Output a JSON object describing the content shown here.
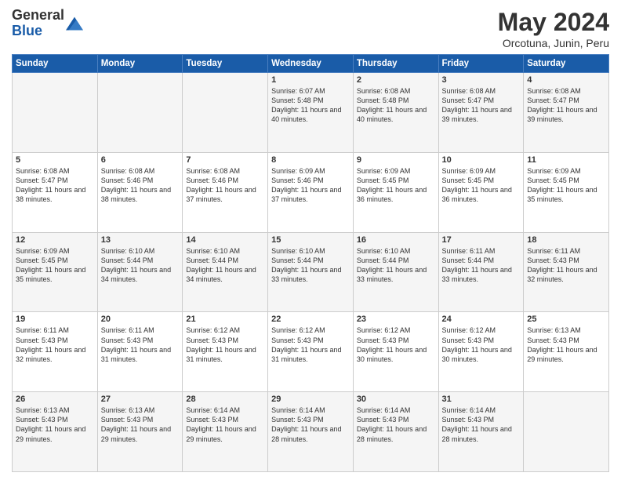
{
  "header": {
    "logo_general": "General",
    "logo_blue": "Blue",
    "month_year": "May 2024",
    "location": "Orcotuna, Junin, Peru"
  },
  "days_of_week": [
    "Sunday",
    "Monday",
    "Tuesday",
    "Wednesday",
    "Thursday",
    "Friday",
    "Saturday"
  ],
  "weeks": [
    [
      {
        "day": "",
        "sunrise": "",
        "sunset": "",
        "daylight": ""
      },
      {
        "day": "",
        "sunrise": "",
        "sunset": "",
        "daylight": ""
      },
      {
        "day": "",
        "sunrise": "",
        "sunset": "",
        "daylight": ""
      },
      {
        "day": "1",
        "sunrise": "Sunrise: 6:07 AM",
        "sunset": "Sunset: 5:48 PM",
        "daylight": "Daylight: 11 hours and 40 minutes."
      },
      {
        "day": "2",
        "sunrise": "Sunrise: 6:08 AM",
        "sunset": "Sunset: 5:48 PM",
        "daylight": "Daylight: 11 hours and 40 minutes."
      },
      {
        "day": "3",
        "sunrise": "Sunrise: 6:08 AM",
        "sunset": "Sunset: 5:47 PM",
        "daylight": "Daylight: 11 hours and 39 minutes."
      },
      {
        "day": "4",
        "sunrise": "Sunrise: 6:08 AM",
        "sunset": "Sunset: 5:47 PM",
        "daylight": "Daylight: 11 hours and 39 minutes."
      }
    ],
    [
      {
        "day": "5",
        "sunrise": "Sunrise: 6:08 AM",
        "sunset": "Sunset: 5:47 PM",
        "daylight": "Daylight: 11 hours and 38 minutes."
      },
      {
        "day": "6",
        "sunrise": "Sunrise: 6:08 AM",
        "sunset": "Sunset: 5:46 PM",
        "daylight": "Daylight: 11 hours and 38 minutes."
      },
      {
        "day": "7",
        "sunrise": "Sunrise: 6:08 AM",
        "sunset": "Sunset: 5:46 PM",
        "daylight": "Daylight: 11 hours and 37 minutes."
      },
      {
        "day": "8",
        "sunrise": "Sunrise: 6:09 AM",
        "sunset": "Sunset: 5:46 PM",
        "daylight": "Daylight: 11 hours and 37 minutes."
      },
      {
        "day": "9",
        "sunrise": "Sunrise: 6:09 AM",
        "sunset": "Sunset: 5:45 PM",
        "daylight": "Daylight: 11 hours and 36 minutes."
      },
      {
        "day": "10",
        "sunrise": "Sunrise: 6:09 AM",
        "sunset": "Sunset: 5:45 PM",
        "daylight": "Daylight: 11 hours and 36 minutes."
      },
      {
        "day": "11",
        "sunrise": "Sunrise: 6:09 AM",
        "sunset": "Sunset: 5:45 PM",
        "daylight": "Daylight: 11 hours and 35 minutes."
      }
    ],
    [
      {
        "day": "12",
        "sunrise": "Sunrise: 6:09 AM",
        "sunset": "Sunset: 5:45 PM",
        "daylight": "Daylight: 11 hours and 35 minutes."
      },
      {
        "day": "13",
        "sunrise": "Sunrise: 6:10 AM",
        "sunset": "Sunset: 5:44 PM",
        "daylight": "Daylight: 11 hours and 34 minutes."
      },
      {
        "day": "14",
        "sunrise": "Sunrise: 6:10 AM",
        "sunset": "Sunset: 5:44 PM",
        "daylight": "Daylight: 11 hours and 34 minutes."
      },
      {
        "day": "15",
        "sunrise": "Sunrise: 6:10 AM",
        "sunset": "Sunset: 5:44 PM",
        "daylight": "Daylight: 11 hours and 33 minutes."
      },
      {
        "day": "16",
        "sunrise": "Sunrise: 6:10 AM",
        "sunset": "Sunset: 5:44 PM",
        "daylight": "Daylight: 11 hours and 33 minutes."
      },
      {
        "day": "17",
        "sunrise": "Sunrise: 6:11 AM",
        "sunset": "Sunset: 5:44 PM",
        "daylight": "Daylight: 11 hours and 33 minutes."
      },
      {
        "day": "18",
        "sunrise": "Sunrise: 6:11 AM",
        "sunset": "Sunset: 5:43 PM",
        "daylight": "Daylight: 11 hours and 32 minutes."
      }
    ],
    [
      {
        "day": "19",
        "sunrise": "Sunrise: 6:11 AM",
        "sunset": "Sunset: 5:43 PM",
        "daylight": "Daylight: 11 hours and 32 minutes."
      },
      {
        "day": "20",
        "sunrise": "Sunrise: 6:11 AM",
        "sunset": "Sunset: 5:43 PM",
        "daylight": "Daylight: 11 hours and 31 minutes."
      },
      {
        "day": "21",
        "sunrise": "Sunrise: 6:12 AM",
        "sunset": "Sunset: 5:43 PM",
        "daylight": "Daylight: 11 hours and 31 minutes."
      },
      {
        "day": "22",
        "sunrise": "Sunrise: 6:12 AM",
        "sunset": "Sunset: 5:43 PM",
        "daylight": "Daylight: 11 hours and 31 minutes."
      },
      {
        "day": "23",
        "sunrise": "Sunrise: 6:12 AM",
        "sunset": "Sunset: 5:43 PM",
        "daylight": "Daylight: 11 hours and 30 minutes."
      },
      {
        "day": "24",
        "sunrise": "Sunrise: 6:12 AM",
        "sunset": "Sunset: 5:43 PM",
        "daylight": "Daylight: 11 hours and 30 minutes."
      },
      {
        "day": "25",
        "sunrise": "Sunrise: 6:13 AM",
        "sunset": "Sunset: 5:43 PM",
        "daylight": "Daylight: 11 hours and 29 minutes."
      }
    ],
    [
      {
        "day": "26",
        "sunrise": "Sunrise: 6:13 AM",
        "sunset": "Sunset: 5:43 PM",
        "daylight": "Daylight: 11 hours and 29 minutes."
      },
      {
        "day": "27",
        "sunrise": "Sunrise: 6:13 AM",
        "sunset": "Sunset: 5:43 PM",
        "daylight": "Daylight: 11 hours and 29 minutes."
      },
      {
        "day": "28",
        "sunrise": "Sunrise: 6:14 AM",
        "sunset": "Sunset: 5:43 PM",
        "daylight": "Daylight: 11 hours and 29 minutes."
      },
      {
        "day": "29",
        "sunrise": "Sunrise: 6:14 AM",
        "sunset": "Sunset: 5:43 PM",
        "daylight": "Daylight: 11 hours and 28 minutes."
      },
      {
        "day": "30",
        "sunrise": "Sunrise: 6:14 AM",
        "sunset": "Sunset: 5:43 PM",
        "daylight": "Daylight: 11 hours and 28 minutes."
      },
      {
        "day": "31",
        "sunrise": "Sunrise: 6:14 AM",
        "sunset": "Sunset: 5:43 PM",
        "daylight": "Daylight: 11 hours and 28 minutes."
      },
      {
        "day": "",
        "sunrise": "",
        "sunset": "",
        "daylight": ""
      }
    ]
  ]
}
